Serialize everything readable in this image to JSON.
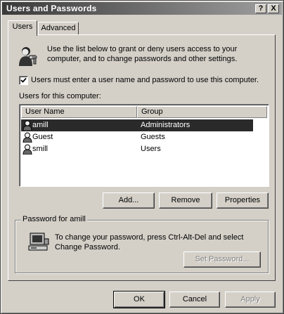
{
  "window": {
    "title": "Users and Passwords",
    "help_btn": "?",
    "close_btn": "X"
  },
  "tabs": [
    {
      "label": "Users",
      "active": true
    },
    {
      "label": "Advanced",
      "active": false
    }
  ],
  "intro": {
    "text": "Use the list below to grant or deny users access to your computer, and to change passwords and other settings."
  },
  "must_login": {
    "label": "Users must enter a user name and password to use this computer.",
    "checked": true
  },
  "users_list": {
    "caption": "Users for this computer:",
    "columns": [
      "User Name",
      "Group"
    ],
    "rows": [
      {
        "name": "amill",
        "group": "Administrators",
        "selected": true
      },
      {
        "name": "Guest",
        "group": "Guests",
        "selected": false
      },
      {
        "name": "smill",
        "group": "Users",
        "selected": false
      }
    ]
  },
  "list_buttons": {
    "add": "Add...",
    "remove": "Remove",
    "properties": "Properties"
  },
  "password_group": {
    "title": "Password for amill",
    "text": "To change your password, press Ctrl-Alt-Del and select Change Password.",
    "set_button": "Set Password..."
  },
  "footer": {
    "ok": "OK",
    "cancel": "Cancel",
    "apply": "Apply"
  },
  "colors": {
    "face": "#d4d0c8",
    "selection": "#2a2a2a"
  }
}
